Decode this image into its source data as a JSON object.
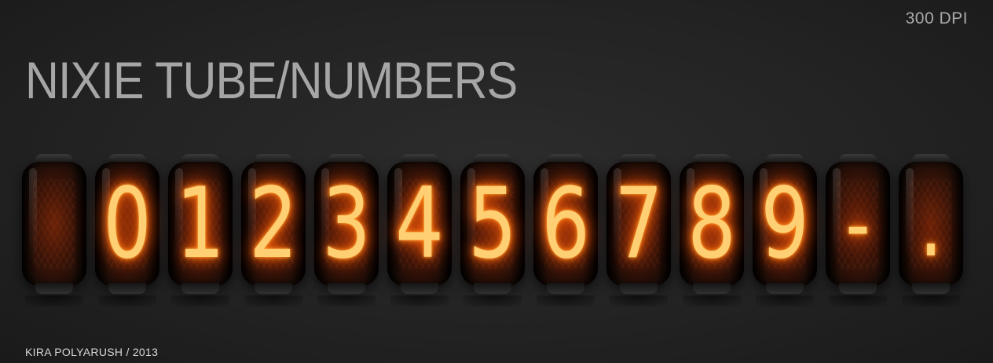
{
  "header": {
    "dpi_label": "300 DPI",
    "title": "NIXIE TUBE/NUMBERS"
  },
  "tubes": [
    {
      "glyph": ""
    },
    {
      "glyph": "0"
    },
    {
      "glyph": "1"
    },
    {
      "glyph": "2"
    },
    {
      "glyph": "3"
    },
    {
      "glyph": "4"
    },
    {
      "glyph": "5"
    },
    {
      "glyph": "6"
    },
    {
      "glyph": "7"
    },
    {
      "glyph": "8"
    },
    {
      "glyph": "9"
    },
    {
      "glyph": "-"
    },
    {
      "glyph": "."
    }
  ],
  "footer": {
    "credit": "KIRA POLYARUSH / 2013"
  },
  "colors": {
    "background": "#232323",
    "title": "#a6a6a6",
    "glow": "#ff7a14",
    "digit": "#ffcf73"
  }
}
